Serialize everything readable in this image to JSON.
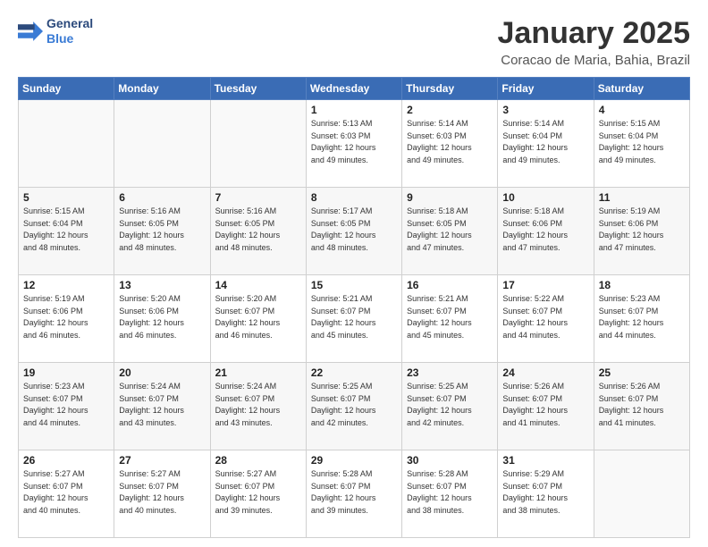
{
  "logo": {
    "line1": "General",
    "line2": "Blue"
  },
  "header": {
    "title": "January 2025",
    "subtitle": "Coracao de Maria, Bahia, Brazil"
  },
  "days_of_week": [
    "Sunday",
    "Monday",
    "Tuesday",
    "Wednesday",
    "Thursday",
    "Friday",
    "Saturday"
  ],
  "weeks": [
    [
      {
        "day": "",
        "info": ""
      },
      {
        "day": "",
        "info": ""
      },
      {
        "day": "",
        "info": ""
      },
      {
        "day": "1",
        "info": "Sunrise: 5:13 AM\nSunset: 6:03 PM\nDaylight: 12 hours\nand 49 minutes."
      },
      {
        "day": "2",
        "info": "Sunrise: 5:14 AM\nSunset: 6:03 PM\nDaylight: 12 hours\nand 49 minutes."
      },
      {
        "day": "3",
        "info": "Sunrise: 5:14 AM\nSunset: 6:04 PM\nDaylight: 12 hours\nand 49 minutes."
      },
      {
        "day": "4",
        "info": "Sunrise: 5:15 AM\nSunset: 6:04 PM\nDaylight: 12 hours\nand 49 minutes."
      }
    ],
    [
      {
        "day": "5",
        "info": "Sunrise: 5:15 AM\nSunset: 6:04 PM\nDaylight: 12 hours\nand 48 minutes."
      },
      {
        "day": "6",
        "info": "Sunrise: 5:16 AM\nSunset: 6:05 PM\nDaylight: 12 hours\nand 48 minutes."
      },
      {
        "day": "7",
        "info": "Sunrise: 5:16 AM\nSunset: 6:05 PM\nDaylight: 12 hours\nand 48 minutes."
      },
      {
        "day": "8",
        "info": "Sunrise: 5:17 AM\nSunset: 6:05 PM\nDaylight: 12 hours\nand 48 minutes."
      },
      {
        "day": "9",
        "info": "Sunrise: 5:18 AM\nSunset: 6:05 PM\nDaylight: 12 hours\nand 47 minutes."
      },
      {
        "day": "10",
        "info": "Sunrise: 5:18 AM\nSunset: 6:06 PM\nDaylight: 12 hours\nand 47 minutes."
      },
      {
        "day": "11",
        "info": "Sunrise: 5:19 AM\nSunset: 6:06 PM\nDaylight: 12 hours\nand 47 minutes."
      }
    ],
    [
      {
        "day": "12",
        "info": "Sunrise: 5:19 AM\nSunset: 6:06 PM\nDaylight: 12 hours\nand 46 minutes."
      },
      {
        "day": "13",
        "info": "Sunrise: 5:20 AM\nSunset: 6:06 PM\nDaylight: 12 hours\nand 46 minutes."
      },
      {
        "day": "14",
        "info": "Sunrise: 5:20 AM\nSunset: 6:07 PM\nDaylight: 12 hours\nand 46 minutes."
      },
      {
        "day": "15",
        "info": "Sunrise: 5:21 AM\nSunset: 6:07 PM\nDaylight: 12 hours\nand 45 minutes."
      },
      {
        "day": "16",
        "info": "Sunrise: 5:21 AM\nSunset: 6:07 PM\nDaylight: 12 hours\nand 45 minutes."
      },
      {
        "day": "17",
        "info": "Sunrise: 5:22 AM\nSunset: 6:07 PM\nDaylight: 12 hours\nand 44 minutes."
      },
      {
        "day": "18",
        "info": "Sunrise: 5:23 AM\nSunset: 6:07 PM\nDaylight: 12 hours\nand 44 minutes."
      }
    ],
    [
      {
        "day": "19",
        "info": "Sunrise: 5:23 AM\nSunset: 6:07 PM\nDaylight: 12 hours\nand 44 minutes."
      },
      {
        "day": "20",
        "info": "Sunrise: 5:24 AM\nSunset: 6:07 PM\nDaylight: 12 hours\nand 43 minutes."
      },
      {
        "day": "21",
        "info": "Sunrise: 5:24 AM\nSunset: 6:07 PM\nDaylight: 12 hours\nand 43 minutes."
      },
      {
        "day": "22",
        "info": "Sunrise: 5:25 AM\nSunset: 6:07 PM\nDaylight: 12 hours\nand 42 minutes."
      },
      {
        "day": "23",
        "info": "Sunrise: 5:25 AM\nSunset: 6:07 PM\nDaylight: 12 hours\nand 42 minutes."
      },
      {
        "day": "24",
        "info": "Sunrise: 5:26 AM\nSunset: 6:07 PM\nDaylight: 12 hours\nand 41 minutes."
      },
      {
        "day": "25",
        "info": "Sunrise: 5:26 AM\nSunset: 6:07 PM\nDaylight: 12 hours\nand 41 minutes."
      }
    ],
    [
      {
        "day": "26",
        "info": "Sunrise: 5:27 AM\nSunset: 6:07 PM\nDaylight: 12 hours\nand 40 minutes."
      },
      {
        "day": "27",
        "info": "Sunrise: 5:27 AM\nSunset: 6:07 PM\nDaylight: 12 hours\nand 40 minutes."
      },
      {
        "day": "28",
        "info": "Sunrise: 5:27 AM\nSunset: 6:07 PM\nDaylight: 12 hours\nand 39 minutes."
      },
      {
        "day": "29",
        "info": "Sunrise: 5:28 AM\nSunset: 6:07 PM\nDaylight: 12 hours\nand 39 minutes."
      },
      {
        "day": "30",
        "info": "Sunrise: 5:28 AM\nSunset: 6:07 PM\nDaylight: 12 hours\nand 38 minutes."
      },
      {
        "day": "31",
        "info": "Sunrise: 5:29 AM\nSunset: 6:07 PM\nDaylight: 12 hours\nand 38 minutes."
      },
      {
        "day": "",
        "info": ""
      }
    ]
  ]
}
